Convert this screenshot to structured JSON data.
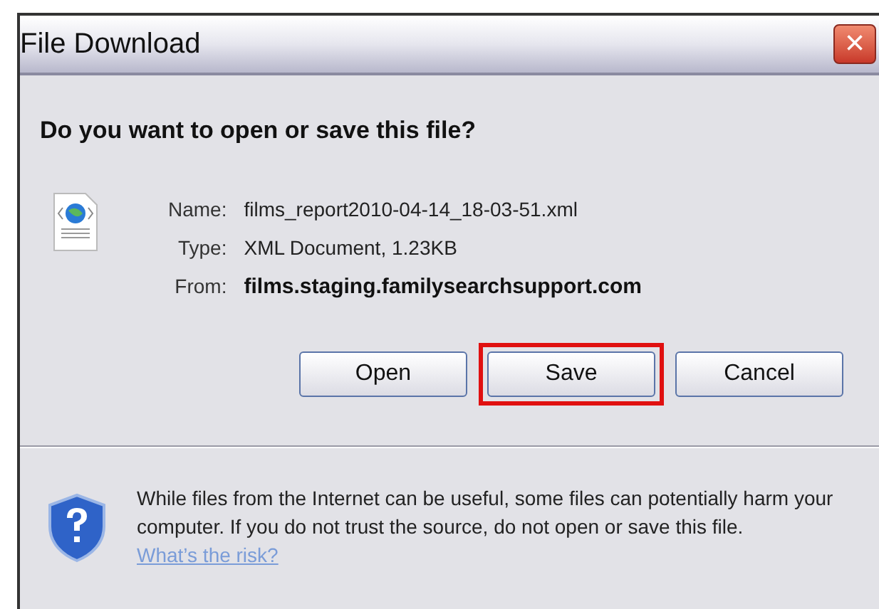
{
  "window": {
    "title": "File Download",
    "close": "×"
  },
  "question": "Do you want to open or save this file?",
  "details": [
    {
      "label": "Name:",
      "value": "films_report2010-04-14_18-03-51.xml",
      "bold": false
    },
    {
      "label": "Type:",
      "value": "XML Document, 1.23KB",
      "bold": false
    },
    {
      "label": "From:",
      "value": "films.staging.familysearchsupport.com",
      "bold": true
    }
  ],
  "buttons": [
    {
      "label": "Open",
      "highlighted": false
    },
    {
      "label": "Save",
      "highlighted": true
    },
    {
      "label": "Cancel",
      "highlighted": false
    }
  ],
  "warning": {
    "text": "While files from the Internet can be useful, some files can potentially harm your computer. If you do not trust the source, do not open or save this file.",
    "link": "What’s the risk?"
  }
}
